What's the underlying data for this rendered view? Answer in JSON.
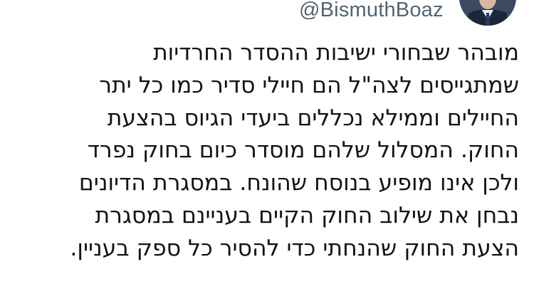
{
  "author": {
    "handle": "@BismuthBoaz"
  },
  "tweet": {
    "lines": [
      "מובהר שבחורי ישיבות ההסדר החרדיות",
      "שמתגייסים לצה\"ל הם חיילי סדיר כמו כל יתר",
      "החיילים וממילא נכללים ביעדי הגיוס בהצעת",
      "החוק. המסלול שלהם מוסדר כיום בחוק נפרד",
      "ולכן אינו מופיע בנוסח שהונח. במסגרת הדיונים",
      "נבחן את שילוב החוק הקיים בעניינם במסגרת",
      "הצעת החוק שהנחתי כדי להסיר כל ספק בעניין."
    ]
  },
  "colors": {
    "text": "#0f1419",
    "secondary_text": "#536471",
    "background": "#ffffff"
  }
}
